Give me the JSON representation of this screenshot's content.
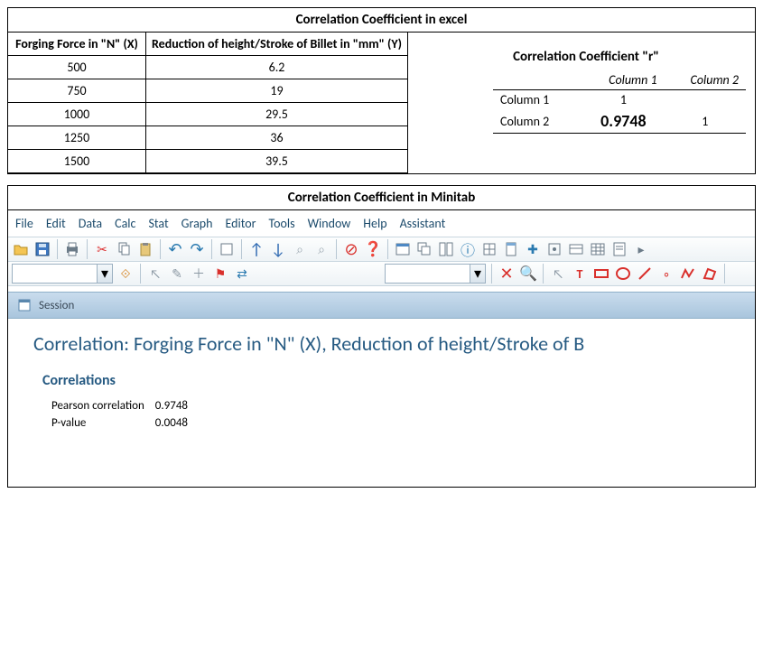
{
  "excel": {
    "title": "Correlation Coefficient in excel",
    "col_x_header": "Forging Force in \"N\" (X)",
    "col_y_header": "Reduction of height/Stroke of Billet in \"mm\" (Y)",
    "rows": [
      {
        "x": "500",
        "y": "6.2"
      },
      {
        "x": "750",
        "y": "19"
      },
      {
        "x": "1000",
        "y": "29.5"
      },
      {
        "x": "1250",
        "y": "36"
      },
      {
        "x": "1500",
        "y": "39.5"
      }
    ],
    "r_title": "Correlation Coefficient \"r\"",
    "matrix": {
      "col1_hdr": "Column 1",
      "col2_hdr": "Column 2",
      "row1_lbl": "Column 1",
      "row2_lbl": "Column 2",
      "r11": "1",
      "r12": "",
      "r21": "0.9748",
      "r22": "1"
    }
  },
  "minitab": {
    "title": "Correlation Coefficient in Minitab",
    "menus": [
      "File",
      "Edit",
      "Data",
      "Calc",
      "Stat",
      "Graph",
      "Editor",
      "Tools",
      "Window",
      "Help",
      "Assistant"
    ],
    "session_label": "Session",
    "analysis_title": "Correlation: Forging Force in \"N\" (X), Reduction of height/Stroke of B",
    "sub_heading": "Correlations",
    "stat1_label": "Pearson correlation",
    "stat1_value": "0.9748",
    "stat2_label": "P-value",
    "stat2_value": "0.0048"
  },
  "chart_data": {
    "type": "table",
    "title": "Correlation analysis between Forging Force (N) and Reduction of height/Stroke of Billet (mm)",
    "series": [
      {
        "name": "Forging Force in N (X)",
        "values": [
          500,
          750,
          1000,
          1250,
          1500
        ]
      },
      {
        "name": "Reduction of height/Stroke of Billet in mm (Y)",
        "values": [
          6.2,
          19,
          29.5,
          36,
          39.5
        ]
      }
    ],
    "correlation_matrix": {
      "labels": [
        "Column 1",
        "Column 2"
      ],
      "values": [
        [
          1,
          null
        ],
        [
          0.9748,
          1
        ]
      ]
    },
    "pearson_correlation": 0.9748,
    "p_value": 0.0048
  }
}
